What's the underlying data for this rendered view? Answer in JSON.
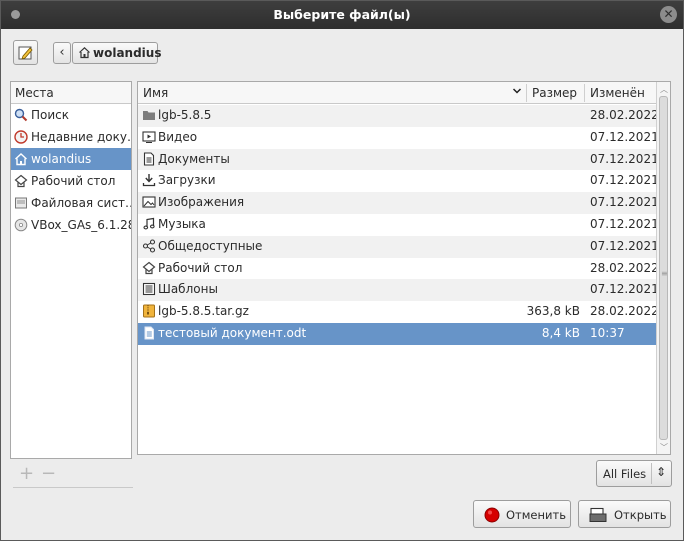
{
  "window": {
    "title": "Выберите файл(ы)"
  },
  "toolbar": {
    "breadcrumb_label": "wolandius"
  },
  "places": {
    "header": "Места",
    "items": [
      {
        "label": "Поиск",
        "icon": "search-icon"
      },
      {
        "label": "Недавние доку…",
        "icon": "recent-icon"
      },
      {
        "label": "wolandius",
        "icon": "home-icon",
        "selected": true
      },
      {
        "label": "Рабочий стол",
        "icon": "desktop-icon"
      },
      {
        "label": "Файловая сист…",
        "icon": "drive-icon"
      },
      {
        "label": "VBox_GAs_6.1.28",
        "icon": "disc-icon"
      }
    ],
    "add_label": "+",
    "remove_label": "−"
  },
  "files": {
    "columns": {
      "name": "Имя",
      "size": "Размер",
      "modified": "Изменён"
    },
    "rows": [
      {
        "name": "lgb-5.8.5",
        "size": "",
        "modified": "28.02.2022",
        "icon": "folder-icon"
      },
      {
        "name": "Видео",
        "size": "",
        "modified": "07.12.2021",
        "icon": "video-folder-icon"
      },
      {
        "name": "Документы",
        "size": "",
        "modified": "07.12.2021",
        "icon": "documents-folder-icon"
      },
      {
        "name": "Загрузки",
        "size": "",
        "modified": "07.12.2021",
        "icon": "downloads-folder-icon"
      },
      {
        "name": "Изображения",
        "size": "",
        "modified": "07.12.2021",
        "icon": "pictures-folder-icon"
      },
      {
        "name": "Музыка",
        "size": "",
        "modified": "07.12.2021",
        "icon": "music-folder-icon"
      },
      {
        "name": "Общедоступные",
        "size": "",
        "modified": "07.12.2021",
        "icon": "share-folder-icon"
      },
      {
        "name": "Рабочий стол",
        "size": "",
        "modified": "28.02.2022",
        "icon": "desktop-icon"
      },
      {
        "name": "Шаблоны",
        "size": "",
        "modified": "07.12.2021",
        "icon": "templates-folder-icon"
      },
      {
        "name": "lgb-5.8.5.tar.gz",
        "size": "363,8 kB",
        "modified": "28.02.2022",
        "icon": "archive-icon"
      },
      {
        "name": "тестовый документ.odt",
        "size": "8,4 kB",
        "modified": "10:37",
        "icon": "text-document-icon",
        "selected": true
      }
    ]
  },
  "filter": {
    "selected": "All Files"
  },
  "buttons": {
    "cancel": "Отменить",
    "open": "Открыть"
  },
  "colors": {
    "selection": "#6794c8",
    "titlebar": "#363636",
    "cancel_icon": "#d60000"
  }
}
